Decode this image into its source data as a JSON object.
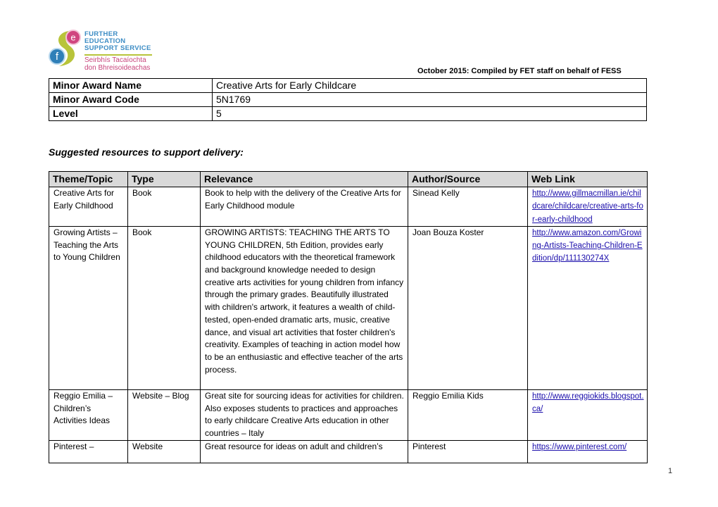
{
  "logo": {
    "line1": "FURTHER EDUCATION",
    "line2": "SUPPORT SERVICE",
    "line3": "Seirbhís Tacaíochta",
    "line4": "don Bhreisoideachas",
    "letter_f": "f",
    "letter_e": "e",
    "colors": {
      "blue": "#2f7fb8",
      "pink": "#d0457f",
      "green": "#b8c43a"
    }
  },
  "compiled_note": "October 2015: Compiled by FET staff on behalf of FESS",
  "award": [
    {
      "label": "Minor Award Name",
      "value": "Creative Arts for Early Childcare"
    },
    {
      "label": "Minor Award Code",
      "value": "5N1769"
    },
    {
      "label": "Level",
      "value": "5"
    }
  ],
  "section_title": "Suggested resources to support delivery:",
  "resources": {
    "headers": [
      "Theme/Topic",
      "Type",
      "Relevance",
      "Author/Source",
      "Web Link"
    ],
    "rows": [
      {
        "topic": "Creative Arts for Early Childhood",
        "type": "Book",
        "relevance": "Book to help with the delivery of the Creative Arts for Early Childhood module",
        "author": "Sinead Kelly",
        "link": "http://www.gillmacmillan.ie/childcare/childcare/creative-arts-for-early-childhood"
      },
      {
        "topic": "Growing Artists – Teaching the Arts to Young Children",
        "type": "Book",
        "relevance": "GROWING ARTISTS: TEACHING THE ARTS TO YOUNG CHILDREN, 5th Edition, provides early childhood educators with the theoretical framework and background knowledge needed to design creative arts activities for young children from infancy through the primary grades. Beautifully illustrated with children's artwork, it features a wealth of child-tested, open-ended dramatic arts, music, creative dance, and visual art activities that foster children's creativity. Examples of teaching in action model how to be an enthusiastic and effective teacher of the arts process.",
        "author": "Joan Bouza Koster",
        "link": "http://www.amazon.com/Growing-Artists-Teaching-Children-Edition/dp/111130274X"
      },
      {
        "topic": "Reggio Emilia – Children’s Activities Ideas",
        "type": "Website – Blog",
        "relevance": "Great site for sourcing ideas for activities for children. Also exposes students to practices and approaches to early childcare Creative Arts education in other countries – Italy",
        "author": "Reggio Emilia Kids",
        "link": "http://www.reggiokids.blogspot.ca/"
      },
      {
        "topic": "Pinterest –",
        "type": "Website",
        "relevance": "Great resource for ideas on adult and children’s",
        "author": "Pinterest",
        "link": "https://www.pinterest.com/"
      }
    ]
  },
  "page_number": "1"
}
